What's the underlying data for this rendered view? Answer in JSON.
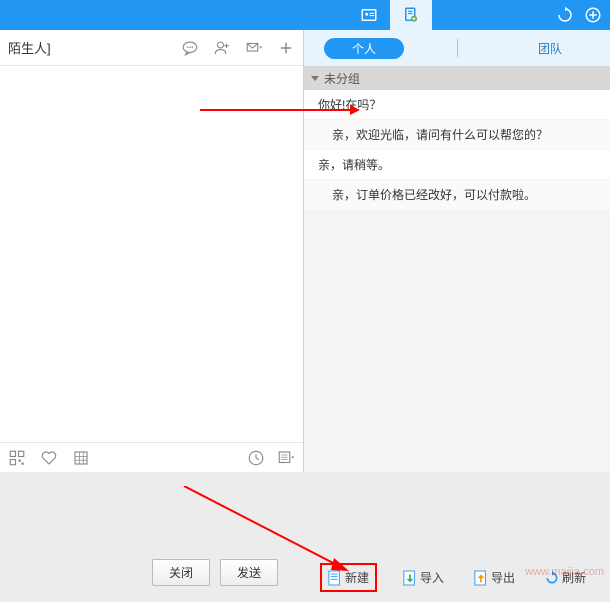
{
  "header": {
    "icon1": "contact-card-icon",
    "icon2": "note-icon"
  },
  "left": {
    "title": "陌生人]",
    "buttons": {
      "close": "关闭",
      "send": "发送"
    }
  },
  "right": {
    "tabs": {
      "personal": "个人",
      "team": "团队"
    },
    "group_label": "未分组",
    "phrases": [
      "你好!在吗？",
      "亲，欢迎光临，请问有什么可以帮您的？",
      "亲，请稍等。",
      "亲，订单价格已经改好，可以付款啦。"
    ]
  },
  "bottom": {
    "new": "新建",
    "import": "导入",
    "export": "导出",
    "refresh": "刷新"
  },
  "watermark": "www.maijia.com",
  "colors": {
    "primary": "#2196f3",
    "highlight": "#ff0000"
  }
}
